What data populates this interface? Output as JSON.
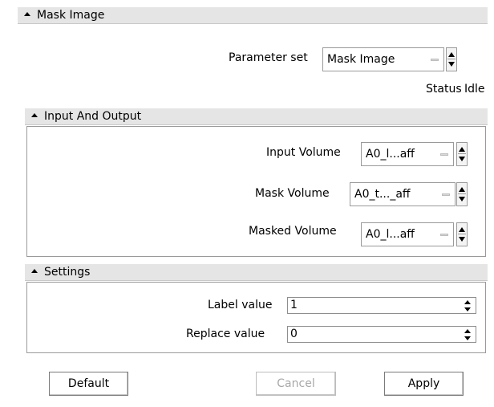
{
  "panel": {
    "title": "Mask Image",
    "parameter_set_label": "Parameter set",
    "parameter_set_value": "Mask Image",
    "status_label": "Status",
    "status_value": "Idle"
  },
  "io": {
    "title": "Input And Output",
    "input_volume_label": "Input Volume",
    "input_volume_value": "A0_l...aff",
    "mask_volume_label": "Mask Volume",
    "mask_volume_value": "A0_t..._aff",
    "masked_volume_label": "Masked Volume",
    "masked_volume_value": "A0_l...aff"
  },
  "settings": {
    "title": "Settings",
    "label_value_label": "Label value",
    "label_value": "1",
    "replace_value_label": "Replace value",
    "replace_value": "0"
  },
  "buttons": {
    "default": "Default",
    "cancel": "Cancel",
    "apply": "Apply"
  }
}
